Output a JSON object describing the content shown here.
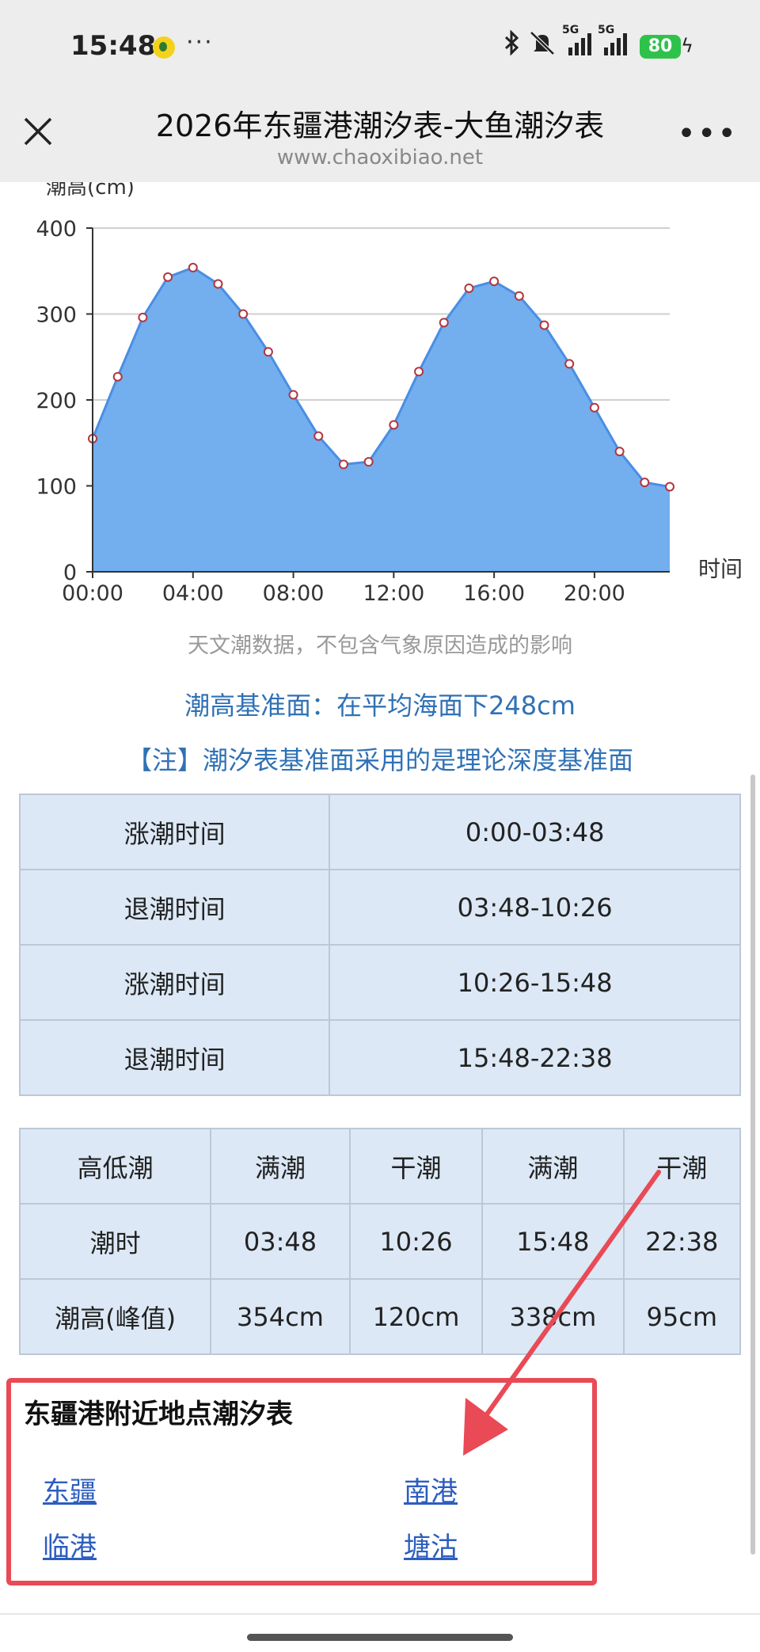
{
  "status_bar": {
    "time": "15:48",
    "more": "···",
    "network_1": "5G",
    "network_2": "5G",
    "battery": "80"
  },
  "header": {
    "title": "2026年东疆港潮汐表-大鱼潮汐表",
    "url": "www.chaoxibiao.net"
  },
  "chart_data": {
    "type": "area",
    "ylabel": "潮高(cm)",
    "xlabel": "时间",
    "ylim": [
      0,
      400
    ],
    "yticks": [
      "0",
      "100",
      "200",
      "300",
      "400"
    ],
    "xticks": [
      "00:00",
      "04:00",
      "08:00",
      "12:00",
      "16:00",
      "20:00"
    ],
    "x": [
      0,
      1,
      2,
      3,
      4,
      5,
      6,
      7,
      8,
      9,
      10,
      11,
      12,
      13,
      14,
      15,
      16,
      17,
      18,
      19,
      20,
      21,
      22,
      23
    ],
    "values": [
      155,
      227,
      296,
      343,
      354,
      335,
      300,
      256,
      206,
      158,
      125,
      128,
      171,
      233,
      290,
      330,
      338,
      321,
      287,
      242,
      191,
      140,
      104,
      99
    ],
    "grid": true,
    "fill_color": "#73aeee",
    "line_color": "#4a8ee4"
  },
  "disclaimer": "天文潮数据，不包含气象原因造成的影响",
  "datum": "潮高基准面：在平均海面下248cm",
  "note": "【注】潮汐表基准面采用的是理论深度基准面",
  "tide_periods": [
    {
      "label": "涨潮时间",
      "value": "0:00-03:48"
    },
    {
      "label": "退潮时间",
      "value": "03:48-10:26"
    },
    {
      "label": "涨潮时间",
      "value": "10:26-15:48"
    },
    {
      "label": "退潮时间",
      "value": "15:48-22:38"
    }
  ],
  "tide_table": {
    "row_labels": [
      "高低潮",
      "潮时",
      "潮高(峰值)"
    ],
    "types": [
      "满潮",
      "干潮",
      "满潮",
      "干潮"
    ],
    "times": [
      "03:48",
      "10:26",
      "15:48",
      "22:38"
    ],
    "heights": [
      "354cm",
      "120cm",
      "338cm",
      "95cm"
    ]
  },
  "nearby": {
    "title": "东疆港附近地点潮汐表",
    "links": [
      "东疆",
      "南港",
      "临港",
      "塘沽"
    ]
  },
  "colors": {
    "annotation": "#e94a55",
    "link": "#2d5dbf",
    "table_bg": "#dce8f5"
  }
}
